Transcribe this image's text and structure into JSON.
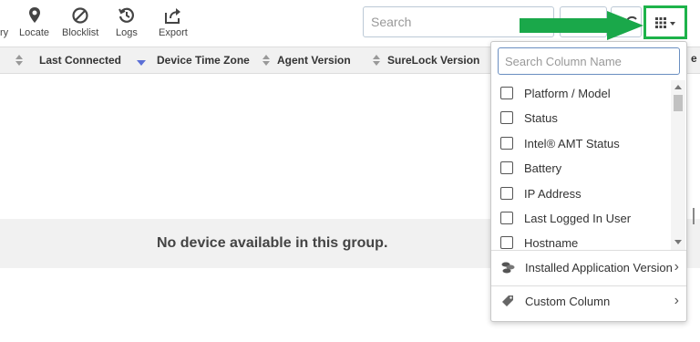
{
  "toolbar": {
    "partial_label": "ry",
    "locate": "Locate",
    "blocklist": "Blocklist",
    "logs": "Logs",
    "export": "Export",
    "search_placeholder": "Search"
  },
  "columns": {
    "last_connected": "Last Connected",
    "device_time_zone": "Device Time Zone",
    "agent_version": "Agent Version",
    "surelock_version": "SureLock Version",
    "partial_col": "e"
  },
  "main": {
    "empty_message": "No device available in this group."
  },
  "column_picker": {
    "search_placeholder": "Search Column Name",
    "items": [
      {
        "label": "Platform / Model"
      },
      {
        "label": "Status"
      },
      {
        "label": "Intel® AMT Status"
      },
      {
        "label": "Battery"
      },
      {
        "label": "IP Address"
      },
      {
        "label": "Last Logged In User"
      },
      {
        "label": "Hostname"
      }
    ],
    "installed_app_version": "Installed Application Version",
    "custom_column": "Custom Column"
  },
  "colors": {
    "highlight": "#1db34a",
    "arrow": "#1aa84a",
    "sort_active": "#5b6fd6"
  }
}
